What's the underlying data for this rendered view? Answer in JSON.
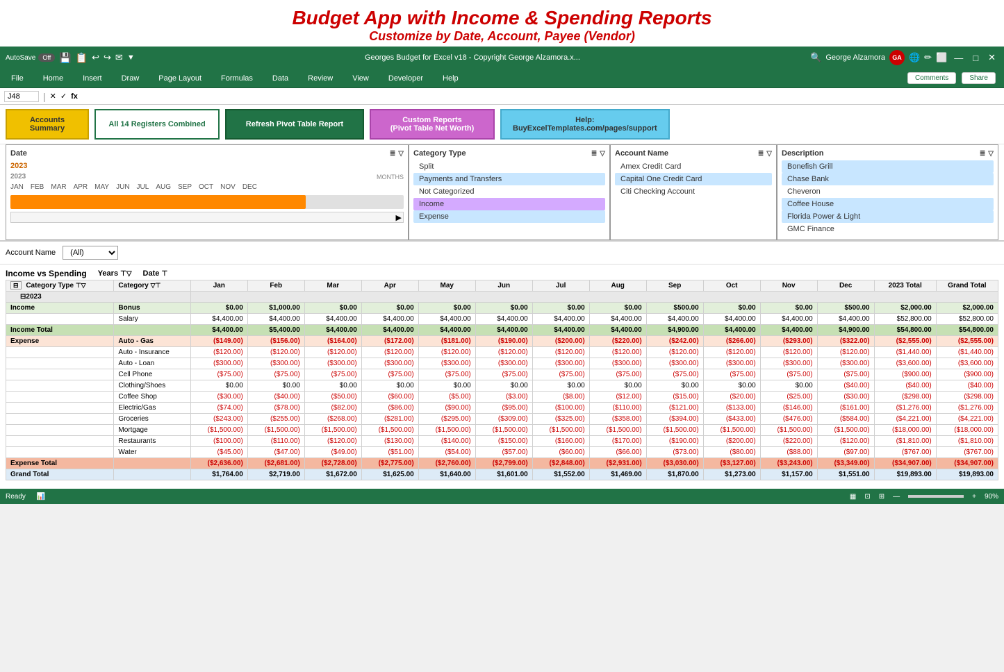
{
  "promo": {
    "title": "Budget App with Income & Spending Reports",
    "subtitle": "Customize by Date, Account, Payee (Vendor)"
  },
  "titlebar": {
    "autosave_label": "AutoSave",
    "autosave_state": "Off",
    "file_name": "Georges Budget for Excel v18 - Copyright George Alzamora.x...",
    "user_name": "George Alzamora",
    "user_initials": "GA"
  },
  "ribbon": {
    "items": [
      "File",
      "Home",
      "Insert",
      "Draw",
      "Page Layout",
      "Formulas",
      "Data",
      "Review",
      "View",
      "Developer",
      "Help"
    ],
    "comments_btn": "Comments",
    "share_btn": "Share"
  },
  "formula_bar": {
    "cell_ref": "J48"
  },
  "top_buttons": {
    "accounts_line1": "Accounts",
    "accounts_line2": "Summary",
    "registers": "All 14 Registers Combined",
    "refresh": "Refresh Pivot Table Report",
    "custom_line1": "Custom Reports",
    "custom_line2": "(Pivot Table Net Worth)",
    "help_line1": "Help:",
    "help_line2": "BuyExcelTemplates.com/pages/support"
  },
  "filters": {
    "date": {
      "header": "Date",
      "year": "2023",
      "months_label": "MONTHS",
      "months": [
        "JAN",
        "FEB",
        "MAR",
        "APR",
        "MAY",
        "JUN",
        "JUL",
        "AUG",
        "SEP",
        "OCT",
        "NOV",
        "DEC"
      ]
    },
    "category": {
      "header": "Category Type",
      "items": [
        "Split",
        "Payments and Transfers",
        "Not Categorized",
        "Income",
        "Expense"
      ]
    },
    "account": {
      "header": "Account Name",
      "items": [
        "Amex Credit Card",
        "Capital One Credit Card",
        "Citi Checking Account"
      ]
    },
    "description": {
      "header": "Description",
      "items": [
        "Bonefish Grill",
        "Chase Bank",
        "Cheveron",
        "Coffee House",
        "Florida Power & Light",
        "GMC Finance"
      ]
    }
  },
  "account_filter": {
    "label": "Account Name",
    "value": "(All)"
  },
  "pivot": {
    "title": "Income vs Spending",
    "years_label": "Years",
    "date_label": "Date",
    "collapse_label": "⊟2023",
    "columns": {
      "type_label": "Category Type",
      "category_label": "Category",
      "months": [
        "Jan",
        "Feb",
        "Mar",
        "Apr",
        "May",
        "Jun",
        "Jul",
        "Aug",
        "Sep",
        "Oct",
        "Nov",
        "Dec"
      ],
      "total_2023": "2023 Total",
      "grand_total": "Grand Total"
    },
    "rows": [
      {
        "type": "Income",
        "category": "Bonus",
        "jan": "$0.00",
        "feb": "$1,000.00",
        "mar": "$0.00",
        "apr": "$0.00",
        "may": "$0.00",
        "jun": "$0.00",
        "jul": "$0.00",
        "aug": "$0.00",
        "sep": "$500.00",
        "oct": "$0.00",
        "nov": "$0.00",
        "dec": "$500.00",
        "total": "$2,000.00",
        "grand": "$2,000.00"
      },
      {
        "type": "",
        "category": "Salary",
        "jan": "$4,400.00",
        "feb": "$4,400.00",
        "mar": "$4,400.00",
        "apr": "$4,400.00",
        "may": "$4,400.00",
        "jun": "$4,400.00",
        "jul": "$4,400.00",
        "aug": "$4,400.00",
        "sep": "$4,400.00",
        "oct": "$4,400.00",
        "nov": "$4,400.00",
        "dec": "$4,400.00",
        "total": "$52,800.00",
        "grand": "$52,800.00"
      },
      {
        "type": "Income Total",
        "category": "",
        "jan": "$4,400.00",
        "feb": "$5,400.00",
        "mar": "$4,400.00",
        "apr": "$4,400.00",
        "may": "$4,400.00",
        "jun": "$4,400.00",
        "jul": "$4,400.00",
        "aug": "$4,400.00",
        "sep": "$4,900.00",
        "oct": "$4,400.00",
        "nov": "$4,400.00",
        "dec": "$4,900.00",
        "total": "$54,800.00",
        "grand": "$54,800.00",
        "is_total": true,
        "row_class": "row-income-total"
      },
      {
        "type": "Expense",
        "category": "Auto - Gas",
        "jan": "($149.00)",
        "feb": "($156.00)",
        "mar": "($164.00)",
        "apr": "($172.00)",
        "may": "($181.00)",
        "jun": "($190.00)",
        "jul": "($200.00)",
        "aug": "($220.00)",
        "sep": "($242.00)",
        "oct": "($266.00)",
        "nov": "($293.00)",
        "dec": "($322.00)",
        "total": "($2,555.00)",
        "grand": "($2,555.00)"
      },
      {
        "type": "",
        "category": "Auto - Insurance",
        "jan": "($120.00)",
        "feb": "($120.00)",
        "mar": "($120.00)",
        "apr": "($120.00)",
        "may": "($120.00)",
        "jun": "($120.00)",
        "jul": "($120.00)",
        "aug": "($120.00)",
        "sep": "($120.00)",
        "oct": "($120.00)",
        "nov": "($120.00)",
        "dec": "($120.00)",
        "total": "($1,440.00)",
        "grand": "($1,440.00)"
      },
      {
        "type": "",
        "category": "Auto - Loan",
        "jan": "($300.00)",
        "feb": "($300.00)",
        "mar": "($300.00)",
        "apr": "($300.00)",
        "may": "($300.00)",
        "jun": "($300.00)",
        "jul": "($300.00)",
        "aug": "($300.00)",
        "sep": "($300.00)",
        "oct": "($300.00)",
        "nov": "($300.00)",
        "dec": "($300.00)",
        "total": "($3,600.00)",
        "grand": "($3,600.00)"
      },
      {
        "type": "",
        "category": "Cell Phone",
        "jan": "($75.00)",
        "feb": "($75.00)",
        "mar": "($75.00)",
        "apr": "($75.00)",
        "may": "($75.00)",
        "jun": "($75.00)",
        "jul": "($75.00)",
        "aug": "($75.00)",
        "sep": "($75.00)",
        "oct": "($75.00)",
        "nov": "($75.00)",
        "dec": "($75.00)",
        "total": "($900.00)",
        "grand": "($900.00)"
      },
      {
        "type": "",
        "category": "Clothing/Shoes",
        "jan": "$0.00",
        "feb": "$0.00",
        "mar": "$0.00",
        "apr": "$0.00",
        "may": "$0.00",
        "jun": "$0.00",
        "jul": "$0.00",
        "aug": "$0.00",
        "sep": "$0.00",
        "oct": "$0.00",
        "nov": "$0.00",
        "dec": "($40.00)",
        "total": "($40.00)",
        "grand": "($40.00)"
      },
      {
        "type": "",
        "category": "Coffee Shop",
        "jan": "($30.00)",
        "feb": "($40.00)",
        "mar": "($50.00)",
        "apr": "($60.00)",
        "may": "($5.00)",
        "jun": "($3.00)",
        "jul": "($8.00)",
        "aug": "($12.00)",
        "sep": "($15.00)",
        "oct": "($20.00)",
        "nov": "($25.00)",
        "dec": "($30.00)",
        "total": "($298.00)",
        "grand": "($298.00)"
      },
      {
        "type": "",
        "category": "Electric/Gas",
        "jan": "($74.00)",
        "feb": "($78.00)",
        "mar": "($82.00)",
        "apr": "($86.00)",
        "may": "($90.00)",
        "jun": "($95.00)",
        "jul": "($100.00)",
        "aug": "($110.00)",
        "sep": "($121.00)",
        "oct": "($133.00)",
        "nov": "($146.00)",
        "dec": "($161.00)",
        "total": "($1,276.00)",
        "grand": "($1,276.00)"
      },
      {
        "type": "",
        "category": "Groceries",
        "jan": "($243.00)",
        "feb": "($255.00)",
        "mar": "($268.00)",
        "apr": "($281.00)",
        "may": "($295.00)",
        "jun": "($309.00)",
        "jul": "($325.00)",
        "aug": "($358.00)",
        "sep": "($394.00)",
        "oct": "($433.00)",
        "nov": "($476.00)",
        "dec": "($584.00)",
        "total": "($4,221.00)",
        "grand": "($4,221.00)"
      },
      {
        "type": "",
        "category": "Mortgage",
        "jan": "($1,500.00)",
        "feb": "($1,500.00)",
        "mar": "($1,500.00)",
        "apr": "($1,500.00)",
        "may": "($1,500.00)",
        "jun": "($1,500.00)",
        "jul": "($1,500.00)",
        "aug": "($1,500.00)",
        "sep": "($1,500.00)",
        "oct": "($1,500.00)",
        "nov": "($1,500.00)",
        "dec": "($1,500.00)",
        "total": "($18,000.00)",
        "grand": "($18,000.00)"
      },
      {
        "type": "",
        "category": "Restaurants",
        "jan": "($100.00)",
        "feb": "($110.00)",
        "mar": "($120.00)",
        "apr": "($130.00)",
        "may": "($140.00)",
        "jun": "($150.00)",
        "jul": "($160.00)",
        "aug": "($170.00)",
        "sep": "($190.00)",
        "oct": "($200.00)",
        "nov": "($220.00)",
        "dec": "($120.00)",
        "total": "($1,810.00)",
        "grand": "($1,810.00)"
      },
      {
        "type": "",
        "category": "Water",
        "jan": "($45.00)",
        "feb": "($47.00)",
        "mar": "($49.00)",
        "apr": "($51.00)",
        "may": "($54.00)",
        "jun": "($57.00)",
        "jul": "($60.00)",
        "aug": "($66.00)",
        "sep": "($73.00)",
        "oct": "($80.00)",
        "nov": "($88.00)",
        "dec": "($97.00)",
        "total": "($767.00)",
        "grand": "($767.00)"
      },
      {
        "type": "Expense Total",
        "category": "",
        "jan": "($2,636.00)",
        "feb": "($2,681.00)",
        "mar": "($2,728.00)",
        "apr": "($2,775.00)",
        "may": "($2,760.00)",
        "jun": "($2,799.00)",
        "jul": "($2,848.00)",
        "aug": "($2,931.00)",
        "sep": "($3,030.00)",
        "oct": "($3,127.00)",
        "nov": "($3,243.00)",
        "dec": "($3,349.00)",
        "total": "($34,907.00)",
        "grand": "($34,907.00)",
        "is_total": true,
        "row_class": "row-expense-total"
      },
      {
        "type": "Grand Total",
        "category": "",
        "jan": "$1,764.00",
        "feb": "$2,719.00",
        "mar": "$1,672.00",
        "apr": "$1,625.00",
        "may": "$1,640.00",
        "jun": "$1,601.00",
        "jul": "$1,552.00",
        "aug": "$1,469.00",
        "sep": "$1,870.00",
        "oct": "$1,273.00",
        "nov": "$1,157.00",
        "dec": "$1,551.00",
        "total": "$19,893.00",
        "grand": "$19,893.00",
        "is_grand": true,
        "row_class": "row-grand-total"
      }
    ]
  },
  "status_bar": {
    "ready": "Ready",
    "view_icons": [
      "normal",
      "page-layout",
      "page-break"
    ],
    "zoom": "90%"
  }
}
